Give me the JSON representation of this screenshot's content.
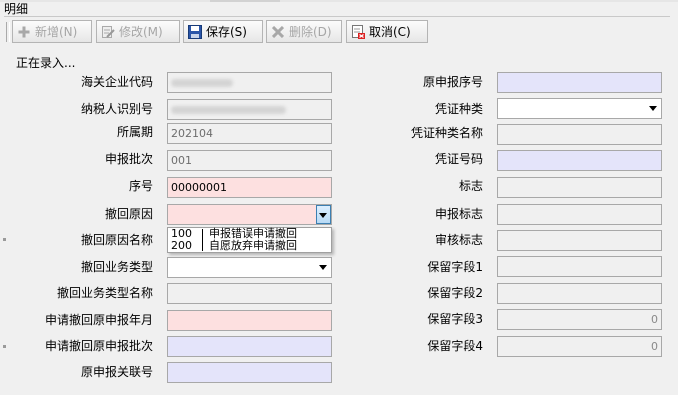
{
  "section_title": "明细",
  "toolbar": {
    "add_label": "新增(N)",
    "edit_label": "修改(M)",
    "save_label": "保存(S)",
    "delete_label": "删除(D)",
    "cancel_label": "取消(C)"
  },
  "status_text": "正在录入...",
  "left_fields": [
    {
      "label": "海关企业代码",
      "value": ""
    },
    {
      "label": "纳税人识别号",
      "value": ""
    },
    {
      "label": "所属期",
      "value": "202104"
    },
    {
      "label": "申报批次",
      "value": "001"
    },
    {
      "label": "序号",
      "value": "00000001"
    },
    {
      "label": "撤回原因",
      "value": ""
    },
    {
      "label": "撤回原因名称",
      "value": ""
    },
    {
      "label": "撤回业务类型",
      "value": ""
    },
    {
      "label": "撤回业务类型名称",
      "value": ""
    },
    {
      "label": "申请撤回原申报年月",
      "value": ""
    },
    {
      "label": "申请撤回原申报批次",
      "value": ""
    },
    {
      "label": "原申报关联号",
      "value": ""
    }
  ],
  "right_fields": [
    {
      "label": "原申报序号",
      "value": ""
    },
    {
      "label": "凭证种类",
      "value": ""
    },
    {
      "label": "凭证种类名称",
      "value": ""
    },
    {
      "label": "凭证号码",
      "value": ""
    },
    {
      "label": "标志",
      "value": ""
    },
    {
      "label": "申报标志",
      "value": ""
    },
    {
      "label": "审核标志",
      "value": ""
    },
    {
      "label": "保留字段1",
      "value": ""
    },
    {
      "label": "保留字段2",
      "value": ""
    },
    {
      "label": "保留字段3",
      "value": "0"
    },
    {
      "label": "保留字段4",
      "value": "0"
    }
  ],
  "withdraw_reason_options": [
    {
      "code": "100",
      "name": "申报错误申请撤回"
    },
    {
      "code": "200",
      "name": "自愿放弃申请撤回"
    }
  ],
  "colors": {
    "required_field": "#fde0e0",
    "lookup_field": "#e4e4fa",
    "readonly_field": "#f0f0f0",
    "window_background": "#f0f0f0"
  },
  "icons": {
    "add": "plus-icon",
    "edit": "edit-icon",
    "save": "floppy-disk-icon",
    "delete": "x-icon",
    "cancel": "cancel-document-icon"
  }
}
